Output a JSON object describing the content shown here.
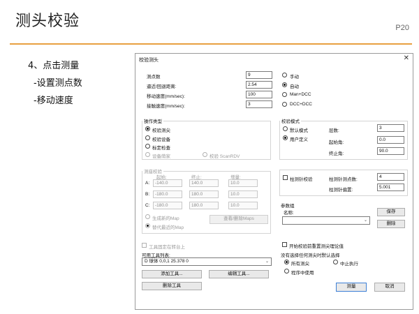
{
  "slide": {
    "title": "测头校验",
    "page_number": "P20",
    "accent_color": "#e8a040",
    "step_heading": "4、点击测量",
    "sub_steps": [
      "-设置测点数",
      "-移动速度"
    ]
  },
  "dialog": {
    "title": "校验测头",
    "close_icon": "close-icon",
    "params": [
      {
        "label": "测点数",
        "value": "9"
      },
      {
        "label": "逼近/回退距离:",
        "value": "2.54"
      },
      {
        "label": "移动速度(mm/sec):",
        "value": "100"
      },
      {
        "label": "接触速度(mm/sec):",
        "value": "3"
      }
    ],
    "mode_options": [
      {
        "label": "手动",
        "selected": false
      },
      {
        "label": "自动",
        "selected": true
      },
      {
        "label": "Man+DCC",
        "selected": false
      },
      {
        "label": "DCC+DCC",
        "selected": false
      }
    ],
    "operation": {
      "label": "操作类型",
      "options": [
        {
          "label": "校验测尖",
          "selected": true,
          "enabled": true
        },
        {
          "label": "校验设备",
          "selected": false,
          "enabled": true
        },
        {
          "label": "标定检查",
          "selected": false,
          "enabled": true
        },
        {
          "label": "设备荫家",
          "selected": false,
          "enabled": false
        },
        {
          "label": "校验 ScanRDV",
          "selected": false,
          "enabled": false
        }
      ]
    },
    "calib_mode": {
      "label": "校验模式",
      "options": [
        {
          "label": "默认模式",
          "selected": false
        },
        {
          "label": "用户定义",
          "selected": true
        }
      ],
      "fields": [
        {
          "label": "层数:",
          "value": "3"
        },
        {
          "label": "起始角:",
          "value": "0.0"
        },
        {
          "label": "终止角:",
          "value": "90.0"
        }
      ]
    },
    "ring_calib": {
      "label": "测座校验",
      "headers": [
        "起始:",
        "终止:",
        "增量:"
      ],
      "rows": [
        {
          "axis": "A:",
          "start": "-140.0",
          "end": "140.0",
          "step": "10.0"
        },
        {
          "axis": "B:",
          "start": "-180.0",
          "end": "180.0",
          "step": "10.0"
        },
        {
          "axis": "C:",
          "start": "-180.0",
          "end": "180.0",
          "step": "10.0"
        }
      ],
      "map_options": [
        "生成新的Map",
        "替代最近的Map"
      ],
      "map_button": "查看/删除Maps"
    },
    "cylinder": {
      "checkbox_label": "柱测针校验",
      "fields": [
        {
          "label": "柱测针测点数:",
          "value": "4"
        },
        {
          "label": "柱测针偏置:",
          "value": "5.001"
        }
      ]
    },
    "param_group": {
      "label": "参数组",
      "name_label": "名称:",
      "name_value": "",
      "save_button": "保存",
      "delete_button": "删除"
    },
    "tool_fixed_label": "工具固定在转台上",
    "available_tools_label": "可用工具列表:",
    "tool_selected": "D  球体  0,0,1  25.378  0",
    "add_tool_button": "添加工具...",
    "edit_tool_button": "编辑工具...",
    "delete_tool_button": "删除工具",
    "reset_checkbox_label": "开始校验前重置测尖理论值",
    "default_choice": {
      "label": "没有选择任何测尖时默认选择",
      "options": [
        {
          "label": "所有测尖",
          "selected": true
        },
        {
          "label": "中止执行",
          "selected": false
        },
        {
          "label": "程序中使用",
          "selected": false
        }
      ]
    },
    "measure_button": "测量",
    "cancel_button": "取消"
  }
}
